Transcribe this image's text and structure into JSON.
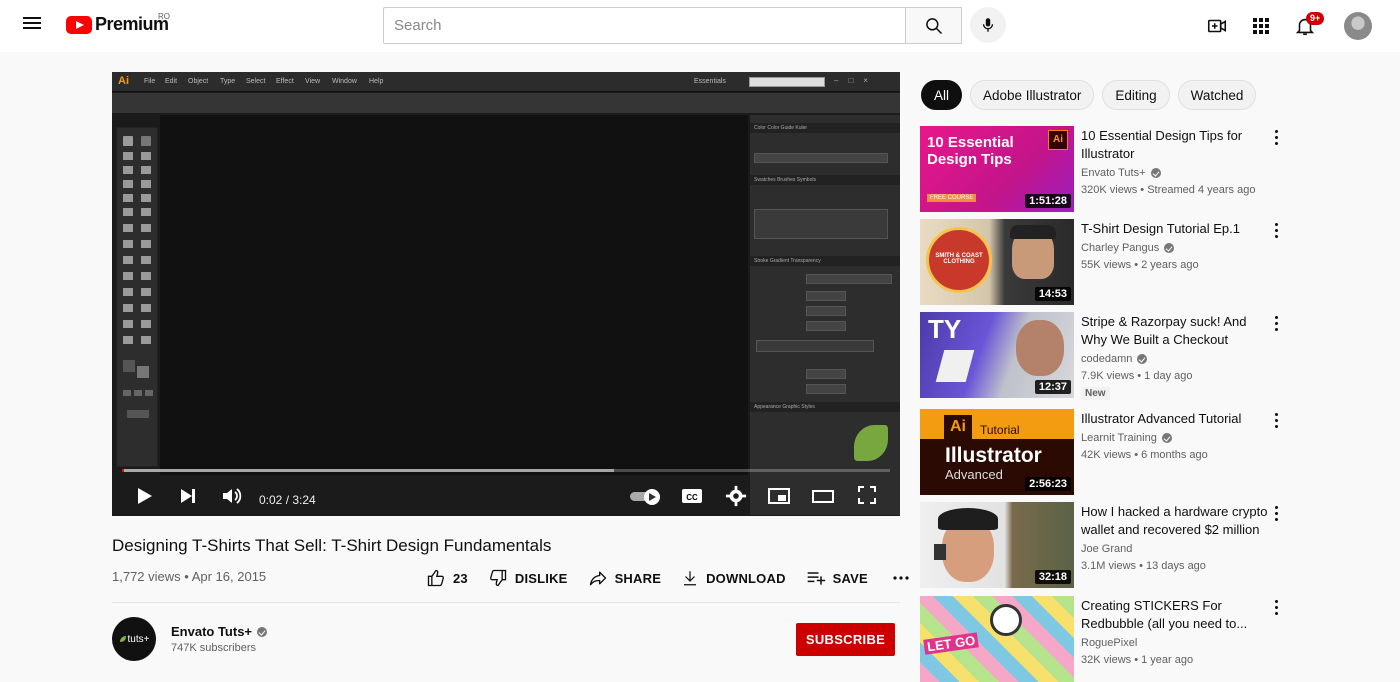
{
  "header": {
    "logo_text": "Premium",
    "region": "RO",
    "search_placeholder": "Search",
    "notification_count": "9+"
  },
  "player": {
    "app_logo": "Ai",
    "app_menu": [
      "File",
      "Edit",
      "Object",
      "Type",
      "Select",
      "Effect",
      "View",
      "Window",
      "Help"
    ],
    "workspace": "Essentials",
    "panels": {
      "color_tabs": "Color  Color Guide  Kuler",
      "swatch_tabs": "Swatches  Brushes  Symbols",
      "stroke_tabs": "Stroke  Gradient  Transparency",
      "appearance_tabs": "Appearance  Graphic Styles"
    },
    "time": "0:02 / 3:24",
    "progress": 0.003,
    "buffered": 0.64
  },
  "video": {
    "title": "Designing T-Shirts That Sell: T-Shirt Design Fundamentals",
    "views_date": "1,772 views • Apr 16, 2015",
    "like_count": "23",
    "dislike_label": "DISLIKE",
    "share_label": "SHARE",
    "download_label": "DOWNLOAD",
    "save_label": "SAVE"
  },
  "channel": {
    "avatar_text": "tuts+",
    "name": "Envato Tuts+",
    "subscribers": "747K subscribers",
    "subscribe_label": "SUBSCRIBE"
  },
  "chips": [
    "All",
    "Adobe Illustrator",
    "Editing",
    "Watched"
  ],
  "recommendations": [
    {
      "title": "10 Essential Design Tips for Illustrator",
      "channel": "Envato Tuts+",
      "meta": "320K views • Streamed 4 years ago",
      "duration": "1:51:28",
      "thumb_text": "10 Essential Design Tips",
      "thumb_badge": "FREE COURSE"
    },
    {
      "title": "T-Shirt Design Tutorial Ep.1",
      "channel": "Charley Pangus",
      "meta": "55K views • 2 years ago",
      "duration": "14:53",
      "thumb_text": "SMITH & COAST CLOTHING"
    },
    {
      "title": "Stripe & Razorpay suck! And Why We Built a Checkout Flow...",
      "channel": "codedamn",
      "meta": "7.9K views • 1 day ago",
      "duration": "12:37",
      "badge": "New",
      "thumb_text": "TY"
    },
    {
      "title": "Illustrator Advanced Tutorial",
      "channel": "Learnit Training",
      "meta": "42K views • 6 months ago",
      "duration": "2:56:23",
      "thumb_ai": "Ai",
      "thumb_tag": "Tutorial",
      "thumb_big": "Illustrator",
      "thumb_sub": "Advanced"
    },
    {
      "title": "How I hacked a hardware crypto wallet and recovered $2 million",
      "channel": "Joe Grand",
      "meta": "3.1M views • 13 days ago",
      "duration": "32:18"
    },
    {
      "title": "Creating STICKERS For Redbubble (all you need to...",
      "channel": "RoguePixel",
      "meta": "32K views • 1 year ago",
      "thumb_text": "LET GO"
    }
  ]
}
